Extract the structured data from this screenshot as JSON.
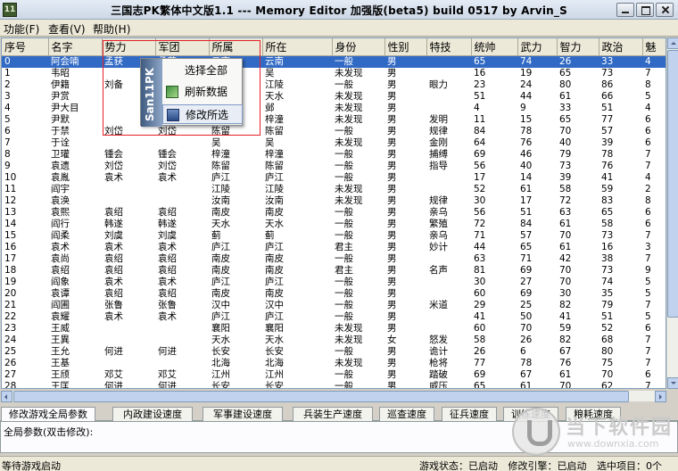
{
  "window": {
    "title": "三国志PK繁体中文版1.1 --- Memory Editor 加强版(beta5) build 0517 by Arvin_S",
    "icon_label": "11"
  },
  "menu": [
    "功能(F)",
    "查看(V)",
    "帮助(H)"
  ],
  "columns": [
    "序号",
    "名字",
    "势力",
    "军团",
    "所属",
    "所在",
    "身份",
    "性别",
    "特技",
    "统帅",
    "武力",
    "智力",
    "政治",
    "魅"
  ],
  "rows": [
    [
      "0",
      "阿会喃",
      "孟获",
      "孟获",
      "云南",
      "云南",
      "一般",
      "男",
      "",
      "65",
      "74",
      "26",
      "33",
      "4"
    ],
    [
      "1",
      "韦昭",
      "",
      "",
      "",
      "吴",
      "未发现",
      "男",
      "",
      "16",
      "19",
      "65",
      "73",
      "7"
    ],
    [
      "2",
      "伊籍",
      "刘备",
      "",
      "",
      "江陵",
      "一般",
      "男",
      "眼力",
      "23",
      "24",
      "80",
      "86",
      "8"
    ],
    [
      "3",
      "尹赏",
      "",
      "",
      "",
      "天水",
      "未发现",
      "男",
      "",
      "51",
      "44",
      "61",
      "66",
      "5"
    ],
    [
      "4",
      "尹大目",
      "",
      "",
      "",
      "邺",
      "未发现",
      "男",
      "",
      "4",
      "9",
      "33",
      "51",
      "4"
    ],
    [
      "5",
      "尹默",
      "",
      "",
      "",
      "梓潼",
      "未发现",
      "男",
      "发明",
      "11",
      "15",
      "65",
      "77",
      "6"
    ],
    [
      "6",
      "于禁",
      "刘岱",
      "刘岱",
      "陈留",
      "陈留",
      "一般",
      "男",
      "规律",
      "84",
      "78",
      "70",
      "57",
      "6"
    ],
    [
      "7",
      "于诠",
      "",
      "",
      "吴",
      "吴",
      "未发现",
      "男",
      "金刚",
      "64",
      "76",
      "40",
      "39",
      "6"
    ],
    [
      "8",
      "卫瓘",
      "锺会",
      "锺会",
      "梓潼",
      "梓潼",
      "一般",
      "男",
      "捕缚",
      "69",
      "46",
      "79",
      "78",
      "7"
    ],
    [
      "9",
      "袁遗",
      "刘岱",
      "刘岱",
      "陈留",
      "陈留",
      "一般",
      "男",
      "指导",
      "56",
      "40",
      "73",
      "76",
      "7"
    ],
    [
      "10",
      "袁胤",
      "袁术",
      "袁术",
      "庐江",
      "庐江",
      "一般",
      "男",
      "",
      "17",
      "14",
      "39",
      "41",
      "4"
    ],
    [
      "11",
      "阎宇",
      "",
      "",
      "江陵",
      "江陵",
      "未发现",
      "男",
      "",
      "52",
      "61",
      "58",
      "59",
      "2"
    ],
    [
      "12",
      "袁涣",
      "",
      "",
      "汝南",
      "汝南",
      "未发现",
      "男",
      "规律",
      "30",
      "17",
      "72",
      "83",
      "8"
    ],
    [
      "13",
      "袁熙",
      "袁绍",
      "袁绍",
      "南皮",
      "南皮",
      "一般",
      "男",
      "亲乌",
      "56",
      "51",
      "63",
      "65",
      "6"
    ],
    [
      "14",
      "阎行",
      "韩遂",
      "韩遂",
      "天水",
      "天水",
      "一般",
      "男",
      "繁殖",
      "72",
      "84",
      "61",
      "58",
      "6"
    ],
    [
      "15",
      "阎柔",
      "刘虞",
      "刘虞",
      "蓟",
      "蓟",
      "一般",
      "男",
      "亲乌",
      "71",
      "57",
      "70",
      "73",
      "7"
    ],
    [
      "16",
      "袁术",
      "袁术",
      "袁术",
      "庐江",
      "庐江",
      "君主",
      "男",
      "妙计",
      "44",
      "65",
      "61",
      "16",
      "3"
    ],
    [
      "17",
      "袁尚",
      "袁绍",
      "袁绍",
      "南皮",
      "南皮",
      "一般",
      "男",
      "",
      "63",
      "71",
      "42",
      "38",
      "7"
    ],
    [
      "18",
      "袁绍",
      "袁绍",
      "袁绍",
      "南皮",
      "南皮",
      "君主",
      "男",
      "名声",
      "81",
      "69",
      "70",
      "73",
      "9"
    ],
    [
      "19",
      "阎象",
      "袁术",
      "袁术",
      "庐江",
      "庐江",
      "一般",
      "男",
      "",
      "30",
      "27",
      "70",
      "74",
      "5"
    ],
    [
      "20",
      "袁谭",
      "袁绍",
      "袁绍",
      "南皮",
      "南皮",
      "一般",
      "男",
      "",
      "60",
      "69",
      "30",
      "35",
      "5"
    ],
    [
      "21",
      "阎圃",
      "张鲁",
      "张鲁",
      "汉中",
      "汉中",
      "一般",
      "男",
      "米道",
      "29",
      "25",
      "82",
      "79",
      "7"
    ],
    [
      "22",
      "袁耀",
      "袁术",
      "袁术",
      "庐江",
      "庐江",
      "一般",
      "男",
      "",
      "41",
      "50",
      "41",
      "51",
      "5"
    ],
    [
      "23",
      "王威",
      "",
      "",
      "襄阳",
      "襄阳",
      "未发现",
      "男",
      "",
      "60",
      "70",
      "59",
      "52",
      "6"
    ],
    [
      "24",
      "王異",
      "",
      "",
      "天水",
      "天水",
      "未发现",
      "女",
      "怒发",
      "58",
      "26",
      "82",
      "68",
      "7"
    ],
    [
      "25",
      "王允",
      "何进",
      "何进",
      "长安",
      "长安",
      "一般",
      "男",
      "诡计",
      "26",
      "6",
      "67",
      "80",
      "7"
    ],
    [
      "26",
      "王基",
      "",
      "",
      "北海",
      "北海",
      "未发现",
      "男",
      "枪将",
      "77",
      "78",
      "76",
      "75",
      "7"
    ],
    [
      "27",
      "王颀",
      "邓艾",
      "邓艾",
      "江州",
      "江州",
      "一般",
      "男",
      "踏破",
      "69",
      "67",
      "61",
      "70",
      "6"
    ],
    [
      "28",
      "王匡",
      "何进",
      "何进",
      "长安",
      "长安",
      "一般",
      "男",
      "威压",
      "65",
      "61",
      "70",
      "62",
      "7"
    ]
  ],
  "selected_row": 0,
  "popup": {
    "side_text": "San11PK",
    "items": [
      "选择全部",
      "刷新数据",
      "修改所选"
    ],
    "hovered": 2
  },
  "tabs": [
    "修改游戏全局参数",
    "内政建设速度",
    "军事建设速度",
    "兵装生产速度",
    "巡查速度",
    "征兵速度",
    "训练速度",
    "粮耗速度"
  ],
  "panel_hint": "全局参数(双击修改):",
  "status": {
    "left": "等待游戏启动",
    "game_state": "游戏状态：已启动",
    "engine_state": "修改引擎：已启动",
    "selected": "选中项目：0个"
  },
  "watermark": {
    "name": "当下软件园",
    "url": "www.downxia.com"
  },
  "colors": {
    "selection": "#316ac5",
    "highlight_box": "#e6202a"
  }
}
